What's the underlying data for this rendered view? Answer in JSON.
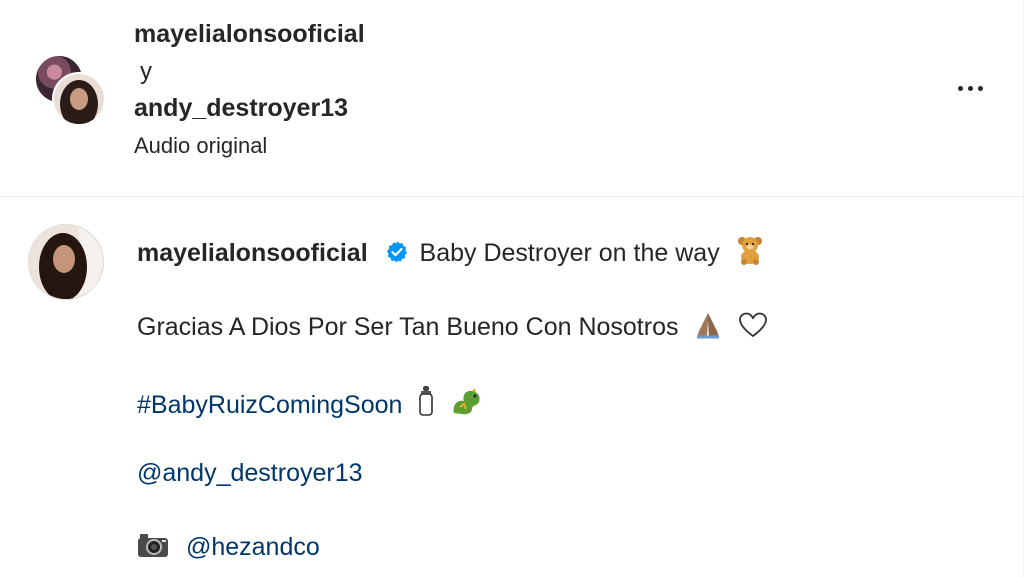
{
  "header": {
    "author1": "mayelialonsooficial",
    "conjunction": "y",
    "author2": "andy_destroyer13",
    "audio": "Audio original"
  },
  "caption": {
    "username": "mayelialonsooficial",
    "verified_icon": "verified-badge-icon",
    "line1": "Baby Destroyer on the way",
    "line1_emoji": "teddy-bear-emoji",
    "line2": "Gracias A Dios Por Ser Tan Bueno Con Nosotros",
    "line2_emojis": [
      "folded-hands-emoji",
      "white-heart-emoji"
    ],
    "hashtag": "#BabyRuizComingSoon",
    "hashtag_emojis": [
      "baby-bottle-emoji",
      "dragon-emoji"
    ],
    "mention1": "@andy_destroyer13",
    "camera_emoji": "camera-emoji",
    "mention2": "@hezandco"
  },
  "colors": {
    "link": "#00376b",
    "verified": "#0095f6",
    "text": "#262626",
    "border": "#efefef"
  }
}
